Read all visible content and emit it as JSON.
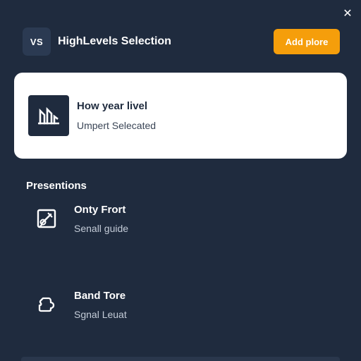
{
  "window": {
    "close_symbol": "✕"
  },
  "header": {
    "logo_text": "VS",
    "title": "HighLevels Selection",
    "action_label": "Add plore"
  },
  "selected_card": {
    "icon": "chart-icon",
    "title": "How year livel",
    "subtitle": "Umpert Selecated"
  },
  "presentations": {
    "heading": "Presentions",
    "items": [
      {
        "icon": "edit-frame-icon",
        "title": "Onty Frort",
        "subtitle": "Senall guide"
      },
      {
        "icon": "shape-outline-icon",
        "title": "Band Tore",
        "subtitle": "Sgnal Leuat"
      }
    ]
  },
  "colors": {
    "background": "#1f2b3e",
    "accent": "#f59e0b",
    "card": "#ffffff"
  }
}
